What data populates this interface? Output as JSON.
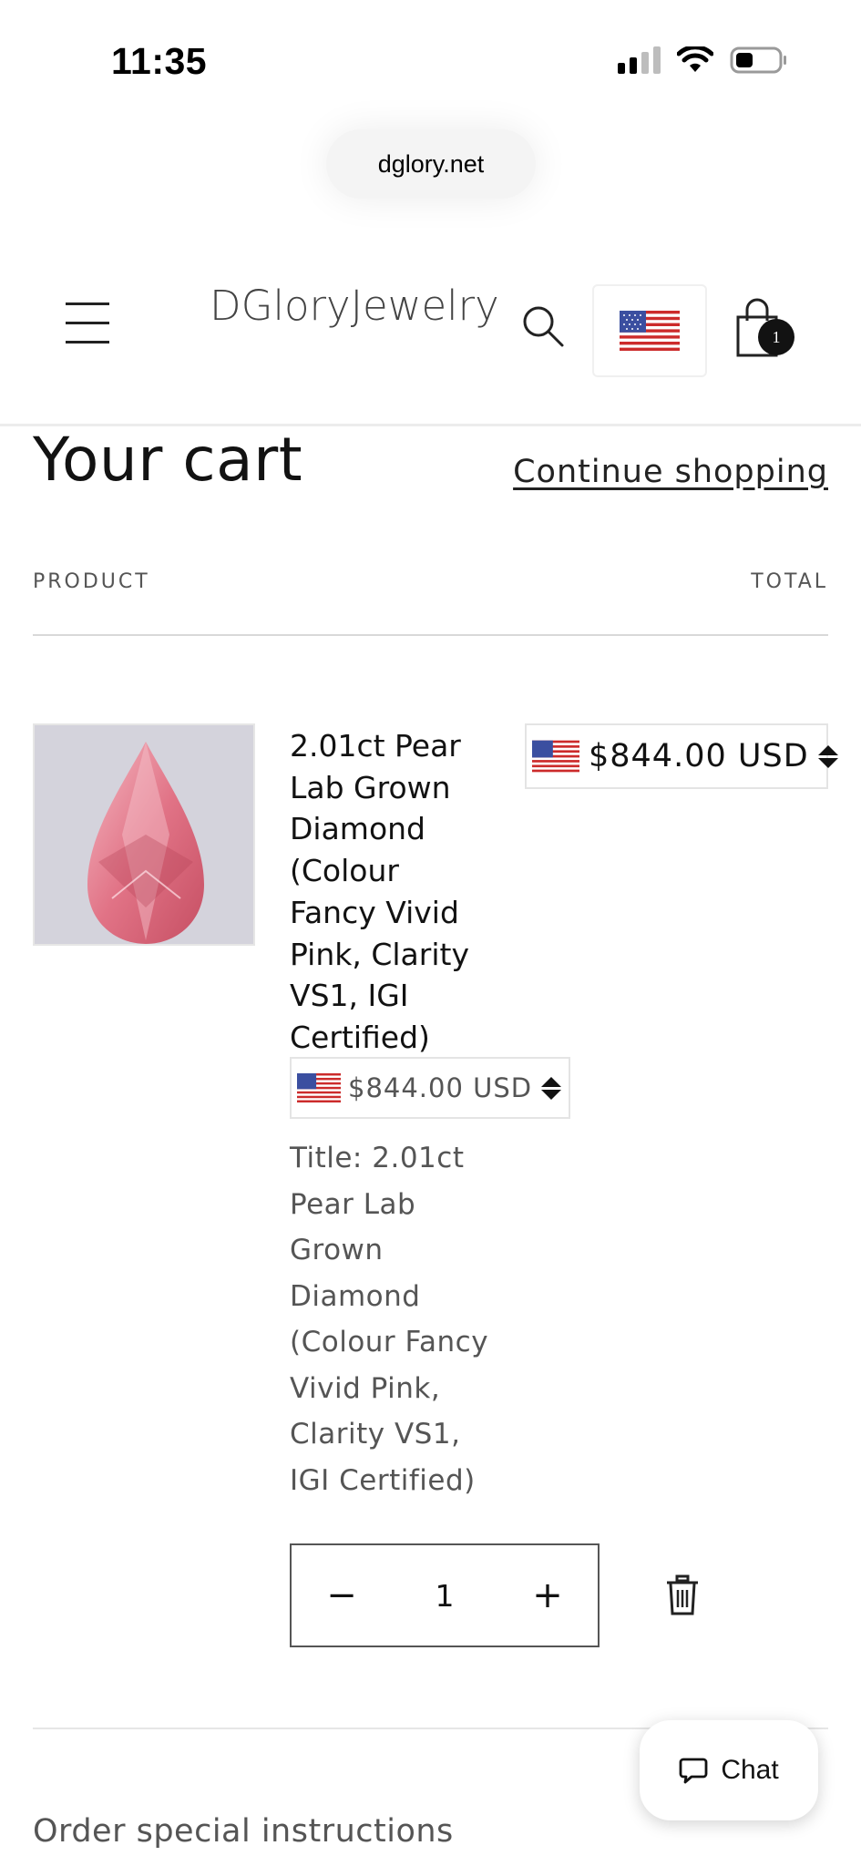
{
  "status_bar": {
    "time": "11:35"
  },
  "browser": {
    "url": "dglory.net"
  },
  "header": {
    "logo": "DGloryJewelry",
    "cart_count": "1"
  },
  "cart": {
    "title": "Your cart",
    "continue_label": "Continue shopping",
    "columns": {
      "product": "PRODUCT",
      "total": "TOTAL"
    },
    "item": {
      "name": "2.01ct Pear Lab Grown Diamond (Colour Fancy Vivid Pink, Clarity VS1, IGI Certified)",
      "line_total": "$844.00 USD",
      "unit_price": "$844.00 USD",
      "option_label": "Title:",
      "option_value": "2.01ct Pear Lab Grown Diamond (Colour Fancy Vivid Pink, Clarity VS1, IGI Certified)",
      "quantity": "1",
      "decrease_symbol": "−",
      "increase_symbol": "+"
    },
    "special_instructions_label": "Order special instructions"
  },
  "chat": {
    "label": "Chat"
  },
  "icons": {
    "menu": "menu-icon",
    "search": "search-icon",
    "flag": "us-flag-icon",
    "cart": "shopping-bag-icon",
    "trash": "trash-icon",
    "chat": "chat-bubble-icon"
  },
  "colors": {
    "text": "#121212",
    "muted": "#555555",
    "border": "#d8d8d8",
    "flag_red": "#cc2b2b",
    "flag_blue": "#3b4fa0"
  }
}
